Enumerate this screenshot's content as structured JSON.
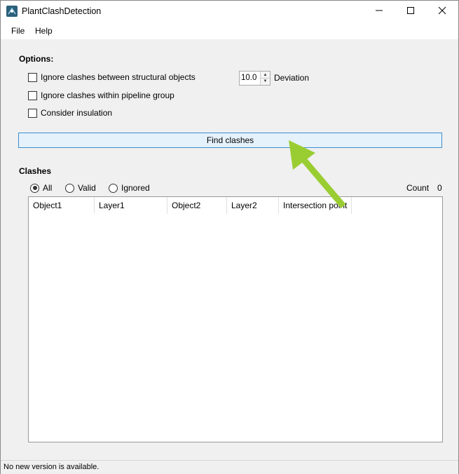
{
  "window": {
    "title": "PlantClashDetection",
    "minimize_glyph": "—",
    "maximize_glyph": "☐",
    "close_glyph": "✕"
  },
  "menu": {
    "items": [
      {
        "label": "File"
      },
      {
        "label": "Help"
      }
    ]
  },
  "options": {
    "heading": "Options:",
    "checkboxes": [
      {
        "label": "Ignore clashes between structural objects",
        "checked": false
      },
      {
        "label": "Ignore clashes within pipeline group",
        "checked": false
      },
      {
        "label": "Consider insulation",
        "checked": false
      }
    ],
    "deviation": {
      "value": "10.0",
      "label": "Deviation"
    }
  },
  "find_button": {
    "label": "Find clashes"
  },
  "clashes": {
    "heading": "Clashes",
    "filters": [
      {
        "label": "All",
        "selected": true
      },
      {
        "label": "Valid",
        "selected": false
      },
      {
        "label": "Ignored",
        "selected": false
      }
    ],
    "count_label": "Count",
    "count_value": "0",
    "columns": [
      "Object1",
      "Layer1",
      "Object2",
      "Layer2",
      "Intersection point"
    ]
  },
  "status": {
    "text": "No new version is available."
  },
  "colors": {
    "accent": "#3c8fd0",
    "annotation_arrow": "#9acd32"
  },
  "icons": {
    "app": "plant-clash-icon",
    "minimize": "minimize-icon",
    "maximize": "maximize-icon",
    "close": "close-icon"
  }
}
